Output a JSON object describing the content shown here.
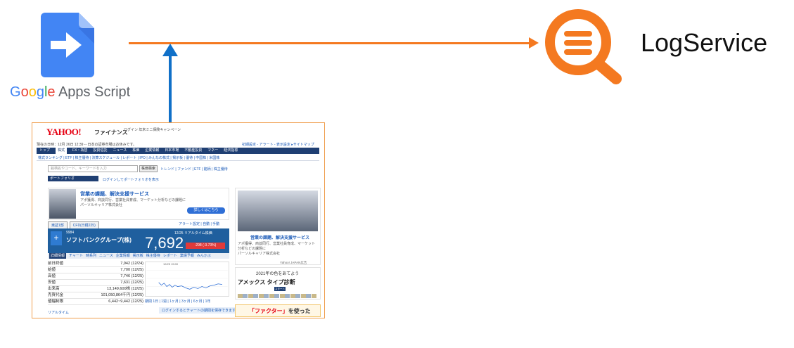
{
  "nodes": {
    "gas": {
      "label_parts": [
        "G",
        "o",
        "o",
        "g",
        "l",
        "e",
        " Apps Script"
      ],
      "icon": "google-apps-script-icon"
    },
    "logservice": {
      "label": "LogService",
      "icon": "magnifier-list-icon",
      "color": "#F47920"
    }
  },
  "edges": {
    "gas_to_log": {
      "color": "#F47920"
    },
    "screen_to_gas": {
      "color": "#1070C8"
    }
  },
  "screenshot": {
    "logo": "YAHOO!",
    "site": "ファイナンス",
    "header_note": "ログイン 年末ミニ保険キャンペーン",
    "date_line": "現在の日時：12月 26日 12:39 -- 日本の証券市場はお休みです。",
    "top_links": "初期設定 - アラート - 表示設定 ▸サイトマップ",
    "nav": [
      "トップ",
      "株式",
      "FX・為替",
      "投資信託",
      "ニュース",
      "株価",
      "企業情報",
      "日本市場",
      "不動産投資",
      "マネー",
      "経済指標"
    ],
    "subnav": "株式ランキング | ETF | 株主優待 | 決算スケジュール | レポート | IPO | みんなの株式 | 掲示板 | 優待 | 中国株 | 米国株",
    "search_placeholder": "銘柄名やコード、キーワードを入力",
    "search_button": "株価検索",
    "trend_text": "トレンド | ファンド | ETF | 銘柄 | 株主優待",
    "portfolio_label": "ポートフォリオ",
    "portfolio_link": "ログインしてポートフォリオを表示",
    "ad1": {
      "title": "営業の課題、解決支援サービス",
      "text": "アポ獲得、商談同行、営業社員育成、マーケット分析などの課題に",
      "company": "パーソルキャリア株式会社",
      "button": "詳しくはこちら"
    },
    "tabs": [
      "東証1部",
      "CFD(日経225)"
    ],
    "alert_row": "アラート設定 | 自動 | 手動",
    "stock": {
      "code": "9984",
      "name": "ソフトバンクグループ(株)",
      "time": "12/25 リアルタイム株価",
      "price": "7,692",
      "change": "-298 (-3.73%)",
      "add_label": "+"
    },
    "subtabs": [
      "詳細情報",
      "チャート",
      "時系列",
      "ニュース",
      "企業情報",
      "掲示板",
      "株主優待",
      "レポート",
      "業績予報",
      "みんかぶ"
    ],
    "stats": [
      {
        "label": "前日終値",
        "value": "7,942 (12/24)"
      },
      {
        "label": "始値",
        "value": "7,700 (12/25)"
      },
      {
        "label": "高値",
        "value": "7,746 (12/25)"
      },
      {
        "label": "安値",
        "value": "7,631 (12/25)"
      },
      {
        "label": "出来高",
        "value": "13,149,600株 (12/25)"
      },
      {
        "label": "売買代金",
        "value": "101,050,864千円 (12/25)"
      },
      {
        "label": "値幅制限",
        "value": "6,442~9,442 (12/25)"
      }
    ],
    "chart_top": "12/25 15:00",
    "chart_periods": "期間 1日 | 1週 | 1ヶ月 | 3ヶ月 | 6ヶ月 | 1年",
    "chart_link": "ログインするとチャートの期間を保存できます",
    "realtime": "リアルタイム",
    "ad2": {
      "title": "営業の課題、解決支援サービス",
      "text": "アポ獲得、商談同行、営業社員育成、マーケット分析などの課題に",
      "company": "パーソルキャリア株式会社",
      "footer": "Yahoo! JAPAN広告"
    },
    "amex": {
      "top": "2021年の色をあてよう",
      "main": "アメックス タイプ診断",
      "start": "スタート"
    },
    "factor": {
      "quote": "「ファクター」",
      "rest": "を使った"
    }
  }
}
